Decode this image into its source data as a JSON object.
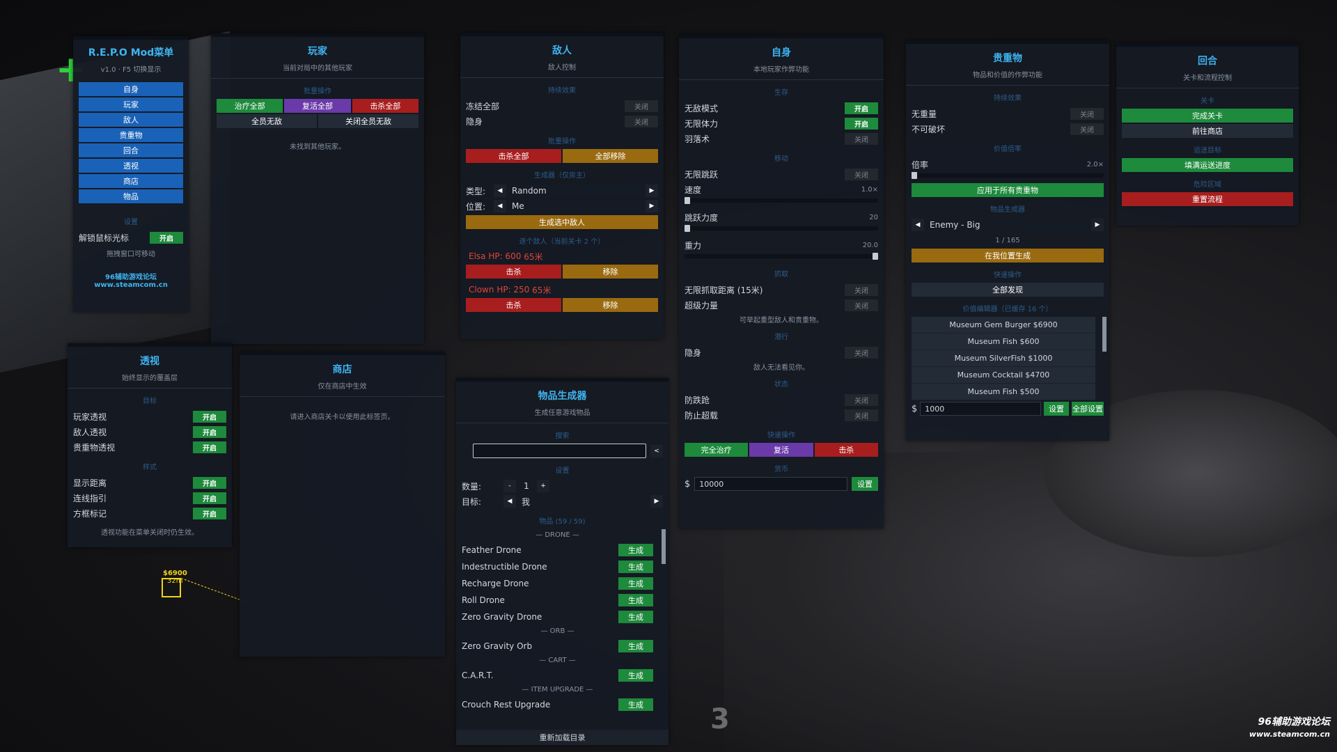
{
  "main_menu": {
    "title": "R.E.P.O Mod菜单",
    "subtitle": "v1.0 · F5 切换显示",
    "nav": [
      "自身",
      "玩家",
      "敌人",
      "贵重物",
      "回合",
      "透视",
      "商店",
      "物品"
    ],
    "settings_section": "设置",
    "unlock_cursor_label": "解锁鼠标光标",
    "unlock_cursor_state": "开启",
    "drag_hint": "拖拽窗口可移动",
    "forum_name": "96辅助游戏论坛",
    "forum_url": "www.steamcom.cn"
  },
  "players": {
    "title": "玩家",
    "subtitle": "当前对局中的其他玩家",
    "batch_section": "批量操作",
    "heal_all": "治疗全部",
    "revive_all": "复活全部",
    "kill_all": "击杀全部",
    "god_all": "全员无敌",
    "god_all_off": "关闭全员无敌",
    "empty": "未找到其他玩家。"
  },
  "enemies": {
    "title": "敌人",
    "subtitle": "敌人控制",
    "persist_section": "持续效果",
    "freeze_all": "冻结全部",
    "freeze_state": "关闭",
    "invisible": "隐身",
    "invisible_state": "关闭",
    "batch_section": "批量操作",
    "kill_all": "击杀全部",
    "remove_all": "全部移除",
    "spawner_section": "生成器（仅房主）",
    "type_label": "类型:",
    "type_value": "Random",
    "pos_label": "位置:",
    "pos_value": "Me",
    "spawn_btn": "生成选中敌人",
    "list_section": "逐个敌人（当前关卡 2 个）",
    "list": [
      {
        "name": "Elsa",
        "hp": "HP:  600",
        "dist": "65米",
        "kill": "击杀",
        "remove": "移除"
      },
      {
        "name": "Clown",
        "hp": "HP:  250",
        "dist": "65米",
        "kill": "击杀",
        "remove": "移除"
      }
    ]
  },
  "self": {
    "title": "自身",
    "subtitle": "本地玩家作弊功能",
    "survive_section": "生存",
    "god": "无敌模式",
    "god_state": "开启",
    "stamina": "无限体力",
    "stamina_state": "开启",
    "feather": "羽落术",
    "feather_state": "关闭",
    "move_section": "移动",
    "jump": "无限跳跃",
    "jump_state": "关闭",
    "speed_label": "速度",
    "speed_value": "1.0×",
    "speed_frac": 0.0,
    "jumpforce_label": "跳跃力度",
    "jumpforce_value": "20",
    "jumpforce_frac": 0.0,
    "gravity_label": "重力",
    "gravity_value": "20.0",
    "gravity_frac": 1.0,
    "grab_section": "抓取",
    "grab_range": "无限抓取距离 (15米)",
    "grab_range_state": "关闭",
    "super_str": "超级力量",
    "super_str_state": "关闭",
    "grab_note": "可举起重型敌人和贵重物。",
    "stealth_section": "潜行",
    "stealth": "隐身",
    "stealth_state": "关闭",
    "stealth_note": "敌人无法看见你。",
    "status_section": "状态",
    "no_trip": "防跌跄",
    "no_trip_state": "关闭",
    "no_overload": "防止超载",
    "no_overload_state": "关闭",
    "quick_section": "快速操作",
    "full_heal": "完全治疗",
    "revive": "复活",
    "kill": "击杀",
    "currency_section": "货币",
    "currency_symbol": "$",
    "currency_value": "10000",
    "set_btn": "设置"
  },
  "valuables": {
    "title": "贵重物",
    "subtitle": "物品和价值的作弊功能",
    "persist_section": "持续效果",
    "no_weight": "无重量",
    "no_weight_state": "关闭",
    "unbreakable": "不可破坏",
    "unbreakable_state": "关闭",
    "mult_section": "价值倍率",
    "mult_label": "倍率",
    "mult_value": "2.0×",
    "mult_frac": 0.0,
    "apply_btn": "应用于所有贵重物",
    "gen_section": "物品生成器",
    "gen_value": "Enemy - Big",
    "gen_count": "1 / 165",
    "spawn_btn": "在我位置生成",
    "quick_section": "快速操作",
    "discover_btn": "全部发现",
    "editor_section": "价值编辑器（已缓存 16 个）",
    "items": [
      "Museum Gem Burger  $6900",
      "Museum Fish  $600",
      "Museum SilverFish  $1000",
      "Museum Cocktail  $4700",
      "Museum Fish  $500"
    ],
    "currency_symbol": "$",
    "value_input": "1000",
    "set_btn": "设置",
    "set_all_btn": "全部设置"
  },
  "round": {
    "title": "回合",
    "subtitle": "关卡和流程控制",
    "level_section": "关卡",
    "complete_btn": "完成关卡",
    "shop_btn": "前往商店",
    "extract_section": "运送目标",
    "fill_btn": "填满运送进度",
    "danger_section": "危险区域",
    "reset_btn": "重置流程"
  },
  "esp": {
    "title": "透视",
    "subtitle": "始终显示的覆盖层",
    "target_section": "目标",
    "player": "玩家透视",
    "player_state": "开启",
    "enemy": "敌人透视",
    "enemy_state": "开启",
    "valuable": "贵重物透视",
    "valuable_state": "开启",
    "style_section": "样式",
    "distance": "显示距离",
    "distance_state": "开启",
    "tracer": "连线指引",
    "tracer_state": "开启",
    "box": "方框标记",
    "box_state": "开启",
    "note": "透视功能在菜单关闭时仍生效。"
  },
  "shop": {
    "title": "商店",
    "subtitle": "仅在商店中生效",
    "note": "请进入商店关卡以使用此标签页。"
  },
  "itemgen": {
    "title": "物品生成器",
    "subtitle": "生成任意游戏物品",
    "search_section": "搜索",
    "clear_btn": "<",
    "settings_section": "设置",
    "qty_label": "数量:",
    "qty_minus": "-",
    "qty_value": "1",
    "qty_plus": "+",
    "target_label": "目标:",
    "target_value": "我",
    "items_section": "物品 (59 / 59)",
    "gen_label": "生成",
    "groups": [
      {
        "cat": "— DRONE —",
        "items": [
          "Feather Drone",
          "Indestructible Drone",
          "Recharge Drone",
          "Roll Drone",
          "Zero Gravity Drone"
        ]
      },
      {
        "cat": "— ORB —",
        "items": [
          "Zero Gravity Orb"
        ]
      },
      {
        "cat": "— CART —",
        "items": [
          "C.A.R.T."
        ]
      },
      {
        "cat": "— ITEM UPGRADE —",
        "items": [
          "Crouch Rest Upgrade"
        ]
      }
    ],
    "reload_btn": "重新加载目录"
  },
  "overlay": {
    "esp_value": "$6900",
    "esp_dist": "32m",
    "watermark_cn": "96辅助游戏论坛",
    "watermark_url": "www.steamcom.cn",
    "floor_number": "3"
  },
  "colors": {
    "accent": "#3fb4f0",
    "on": "#1e8a3c",
    "danger": "#a81e1e",
    "warn": "#9a6a10",
    "purple": "#6a3aa8",
    "nav": "#1a62b8"
  }
}
